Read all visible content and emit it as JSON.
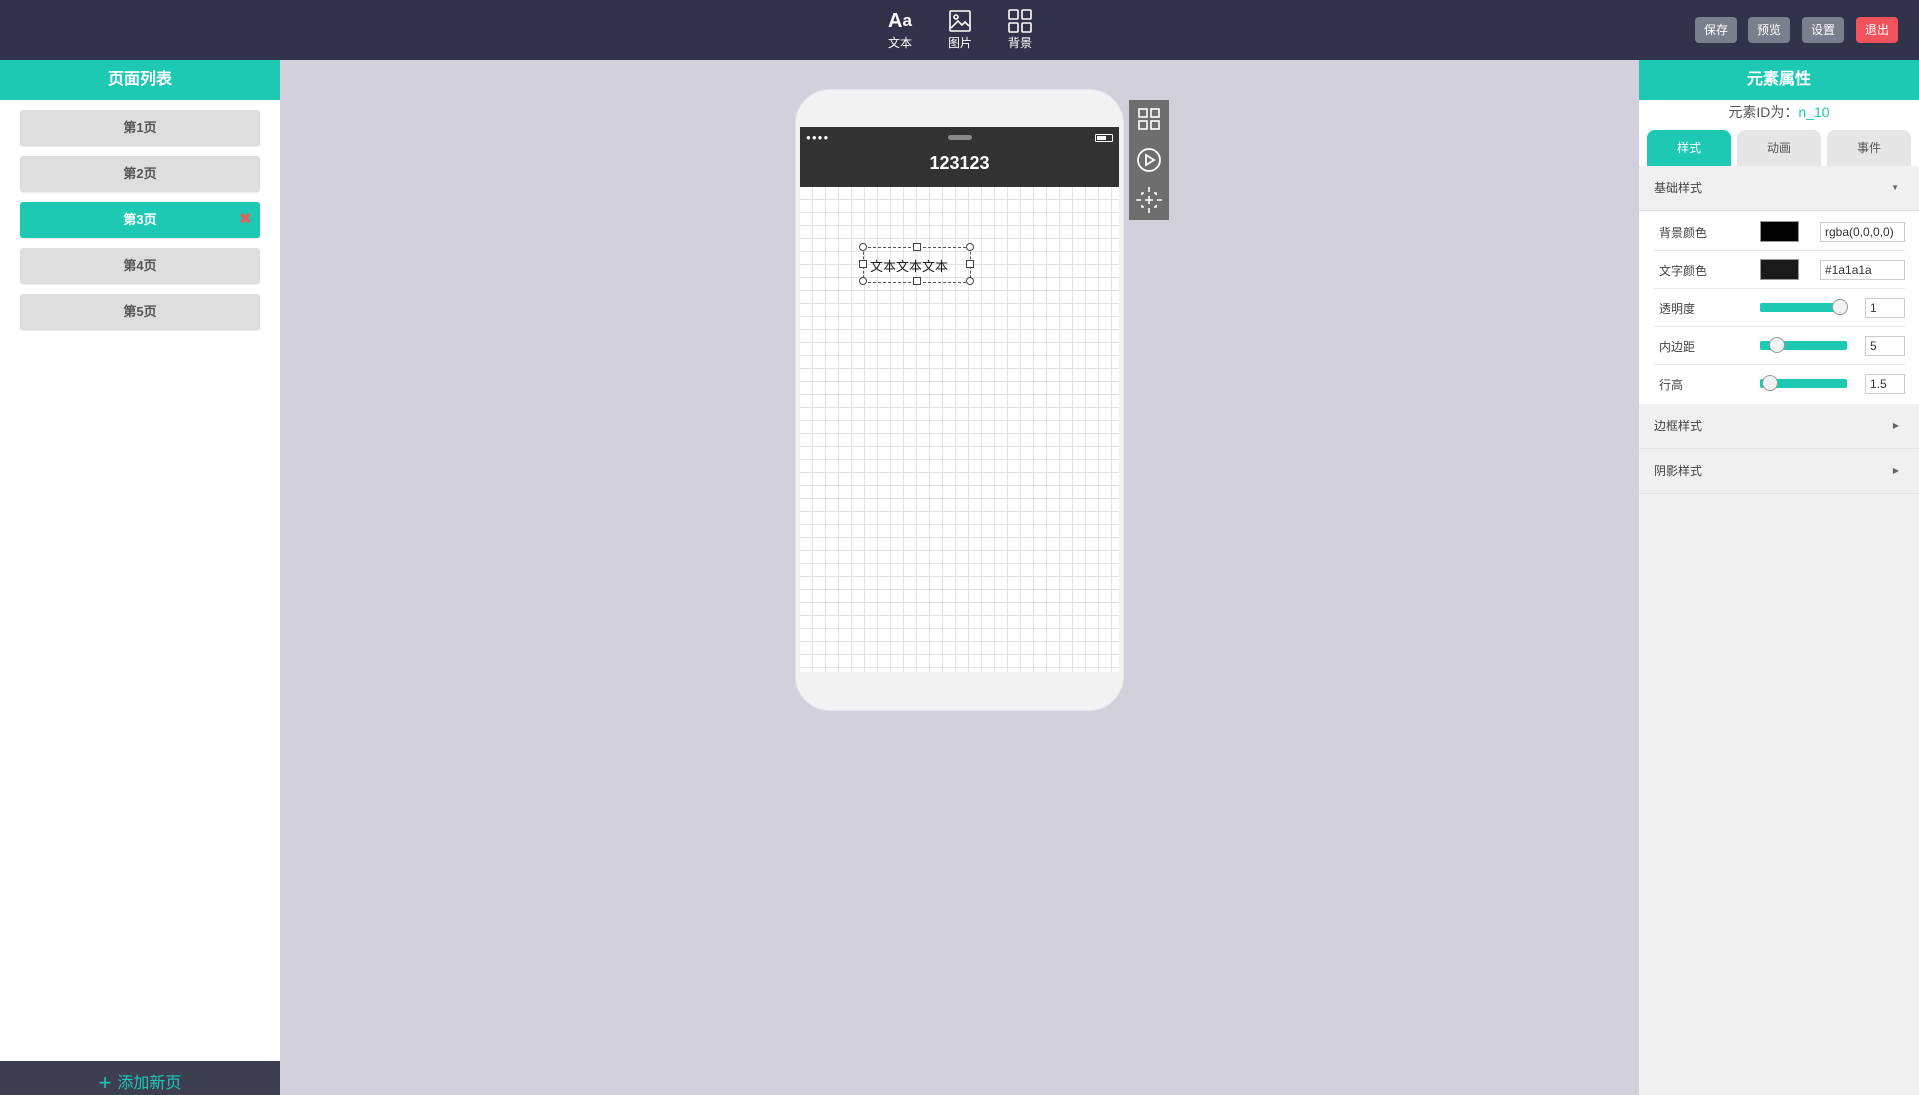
{
  "toolbar": {
    "tools": [
      {
        "label": "文本",
        "icon": "text-icon"
      },
      {
        "label": "图片",
        "icon": "image-icon"
      },
      {
        "label": "背景",
        "icon": "grid-icon"
      }
    ],
    "buttons": {
      "save": "保存",
      "preview": "预览",
      "settings": "设置",
      "exit": "退出"
    },
    "colors": {
      "bg": "#30334a",
      "exit": "#f2525b"
    }
  },
  "left_panel": {
    "title": "页面列表",
    "pages": [
      {
        "label": "第1页",
        "active": false
      },
      {
        "label": "第2页",
        "active": false
      },
      {
        "label": "第3页",
        "active": true
      },
      {
        "label": "第4页",
        "active": false
      },
      {
        "label": "第5页",
        "active": false
      }
    ],
    "delete_symbol": "✖",
    "add_page": "添加新页",
    "accent": "#1ec9b4"
  },
  "canvas": {
    "page_title": "123123",
    "text_element": "文本文本文本",
    "side_tools": [
      "grid-icon",
      "play-icon",
      "align-center-icon"
    ]
  },
  "right_panel": {
    "title": "元素属性",
    "element_id_label": "元素ID为：",
    "element_id": "n_10",
    "tabs": [
      {
        "label": "样式",
        "active": true
      },
      {
        "label": "动画",
        "active": false
      },
      {
        "label": "事件",
        "active": false
      }
    ],
    "basic_section": {
      "title": "基础样式",
      "expanded": true,
      "bg_color_label": "背景颜色",
      "bg_color_value": "rgba(0,0,0,0)",
      "text_color_label": "文字颜色",
      "text_color_value": "#1a1a1a",
      "opacity_label": "透明度",
      "opacity_value": "1",
      "opacity_fraction": 0.92,
      "padding_label": "内边距",
      "padding_value": "5",
      "padding_fraction": 0.19,
      "line_height_label": "行高",
      "line_height_value": "1.5",
      "line_height_fraction": 0.12
    },
    "border_section": {
      "title": "边框样式",
      "expanded": false
    },
    "shadow_section": {
      "title": "阴影样式",
      "expanded": false
    }
  }
}
